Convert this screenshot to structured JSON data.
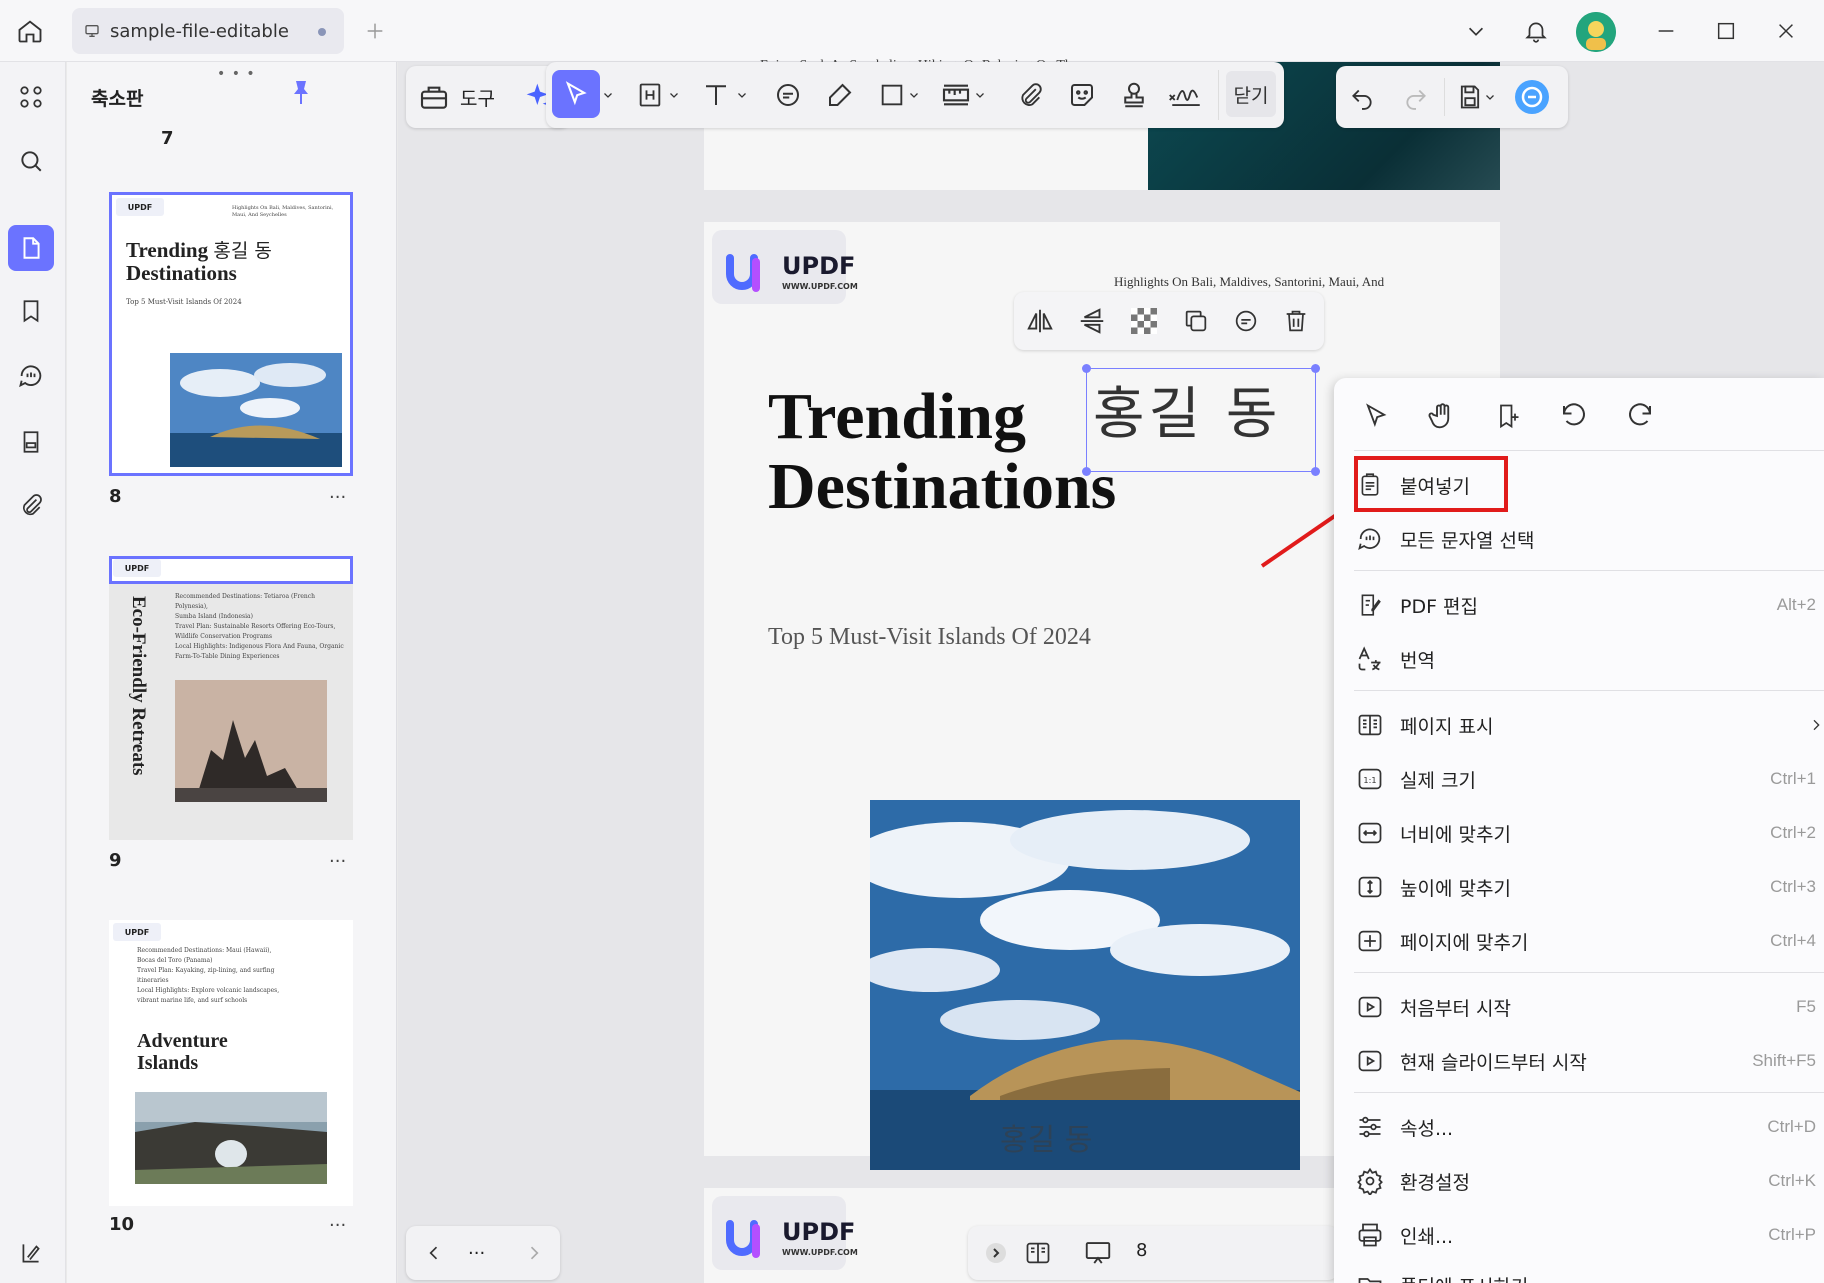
{
  "tab": {
    "title": "sample-file-editable"
  },
  "thumbnails": {
    "title": "축소판",
    "top_number": "7",
    "pages": [
      {
        "number": "8",
        "more": "...",
        "title_line1": "Trending",
        "title_line2": "Destinations",
        "signature": "홍길 동",
        "subtitle": "Top 5 Must-Visit Islands Of 2024",
        "header": "Highlights On Bali, Maldives, Santorini, Maui, And Seychelles"
      },
      {
        "number": "9",
        "more": "...",
        "vertical_title": "Eco-Friendly Retreats",
        "lines": [
          "Recommended Destinations: Tetiaroa (French Polynesia),",
          "Sumba Island (Indonesia)",
          "Travel Plan: Sustainable Resorts Offering Eco-Tours,",
          "Wildlife Conservation Programs",
          "Local Highlights: Indigenous Flora And Fauna, Organic",
          "Farm-To-Table Dining Experiences"
        ]
      },
      {
        "number": "10",
        "more": "...",
        "title_line1": "Adventure",
        "title_line2": "Islands",
        "lines": [
          "Recommended Destinations: Maui (Hawaii),",
          "Bocas del Toro (Panama)",
          "Travel Plan: Kayaking, zip-lining, and surfing",
          "itineraries",
          "Local Highlights: Explore volcanic landscapes,",
          "vibrant marine life, and surf schools"
        ]
      }
    ]
  },
  "toolbar": {
    "tools_label": "도구",
    "close_label": "닫기"
  },
  "document": {
    "top_cut_text": "Enjoy, Such As Snorkeling, Hiking, Or Relaxing On The",
    "logo_text": "UPDF",
    "logo_sub": "WWW.UPDF.COM",
    "header_text": "Highlights On Bali, Maldives, Santorini, Maui, And",
    "title_line1": "Trending",
    "title_line2": "Destinations",
    "signature": "홍길 동",
    "subtitle": "Top 5 Must-Visit Islands Of 2024",
    "watermark_sig": "홍길 동"
  },
  "bottom_nav": {
    "more": "...",
    "page_partial": "8"
  },
  "context_menu": {
    "items": [
      {
        "label": "붙여넣기",
        "shortcut": ""
      },
      {
        "label": "모든 문자열 선택",
        "shortcut": ""
      },
      {
        "label": "PDF 편집",
        "shortcut": "Alt+2"
      },
      {
        "label": "번역",
        "shortcut": ""
      },
      {
        "label": "페이지 표시",
        "shortcut": ""
      },
      {
        "label": "실제 크기",
        "shortcut": "Ctrl+1"
      },
      {
        "label": "너비에 맞추기",
        "shortcut": "Ctrl+2"
      },
      {
        "label": "높이에 맞추기",
        "shortcut": "Ctrl+3"
      },
      {
        "label": "페이지에 맞추기",
        "shortcut": "Ctrl+4"
      },
      {
        "label": "처음부터 시작",
        "shortcut": "F5"
      },
      {
        "label": "현재 슬라이드부터 시작",
        "shortcut": "Shift+F5"
      },
      {
        "label": "속성...",
        "shortcut": "Ctrl+D"
      },
      {
        "label": "환경설정",
        "shortcut": "Ctrl+K"
      },
      {
        "label": "인쇄...",
        "shortcut": "Ctrl+P"
      },
      {
        "label": "폴더에 표시하기",
        "shortcut": ""
      }
    ]
  },
  "colors": {
    "accent": "#6b73ff",
    "highlight_box": "#e11b1b",
    "arrow": "#e11b1b"
  }
}
